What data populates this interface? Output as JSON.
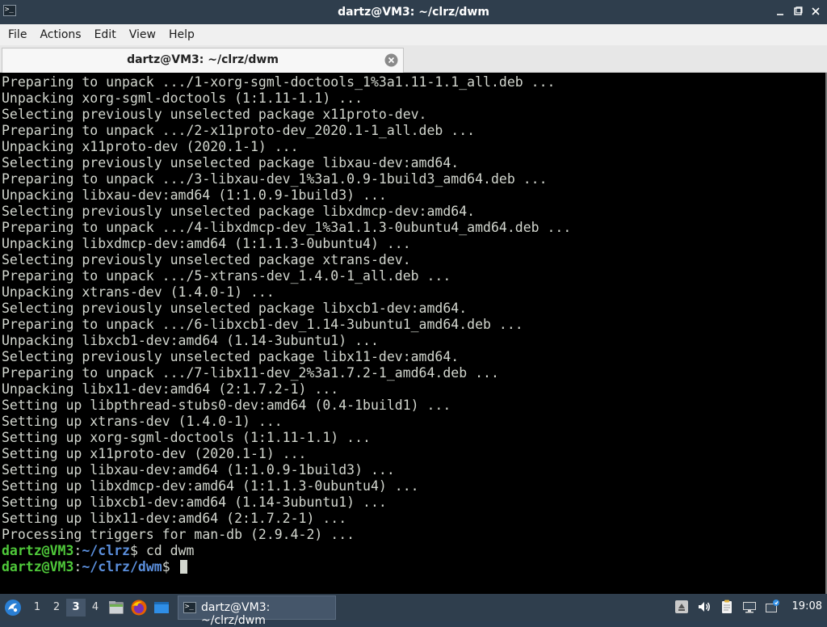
{
  "window": {
    "title": "dartz@VM3: ~/clrz/dwm",
    "app_icon_glyph": ">_"
  },
  "menubar": {
    "items": [
      "File",
      "Actions",
      "Edit",
      "View",
      "Help"
    ]
  },
  "tab": {
    "label": "dartz@VM3: ~/clrz/dwm"
  },
  "terminal": {
    "lines": [
      "Preparing to unpack .../1-xorg-sgml-doctools_1%3a1.11-1.1_all.deb ...",
      "Unpacking xorg-sgml-doctools (1:1.11-1.1) ...",
      "Selecting previously unselected package x11proto-dev.",
      "Preparing to unpack .../2-x11proto-dev_2020.1-1_all.deb ...",
      "Unpacking x11proto-dev (2020.1-1) ...",
      "Selecting previously unselected package libxau-dev:amd64.",
      "Preparing to unpack .../3-libxau-dev_1%3a1.0.9-1build3_amd64.deb ...",
      "Unpacking libxau-dev:amd64 (1:1.0.9-1build3) ...",
      "Selecting previously unselected package libxdmcp-dev:amd64.",
      "Preparing to unpack .../4-libxdmcp-dev_1%3a1.1.3-0ubuntu4_amd64.deb ...",
      "Unpacking libxdmcp-dev:amd64 (1:1.1.3-0ubuntu4) ...",
      "Selecting previously unselected package xtrans-dev.",
      "Preparing to unpack .../5-xtrans-dev_1.4.0-1_all.deb ...",
      "Unpacking xtrans-dev (1.4.0-1) ...",
      "Selecting previously unselected package libxcb1-dev:amd64.",
      "Preparing to unpack .../6-libxcb1-dev_1.14-3ubuntu1_amd64.deb ...",
      "Unpacking libxcb1-dev:amd64 (1.14-3ubuntu1) ...",
      "Selecting previously unselected package libx11-dev:amd64.",
      "Preparing to unpack .../7-libx11-dev_2%3a1.7.2-1_amd64.deb ...",
      "Unpacking libx11-dev:amd64 (2:1.7.2-1) ...",
      "Setting up libpthread-stubs0-dev:amd64 (0.4-1build1) ...",
      "Setting up xtrans-dev (1.4.0-1) ...",
      "Setting up xorg-sgml-doctools (1:1.11-1.1) ...",
      "Setting up x11proto-dev (2020.1-1) ...",
      "Setting up libxau-dev:amd64 (1:1.0.9-1build3) ...",
      "Setting up libxdmcp-dev:amd64 (1:1.1.3-0ubuntu4) ...",
      "Setting up libxcb1-dev:amd64 (1.14-3ubuntu1) ...",
      "Setting up libx11-dev:amd64 (2:1.7.2-1) ...",
      "Processing triggers for man-db (2.9.4-2) ..."
    ],
    "prompts": [
      {
        "user": "dartz@VM3",
        "sep": ":",
        "path": "~/clrz",
        "symbol": "$",
        "command": " cd dwm"
      },
      {
        "user": "dartz@VM3",
        "sep": ":",
        "path": "~/clrz/dwm",
        "symbol": "$",
        "command": " "
      }
    ]
  },
  "taskbar": {
    "desktops": [
      "1",
      "2",
      "3",
      "4"
    ],
    "active_desktop": "3",
    "task_label": "dartz@VM3: ~/clrz/dwm",
    "task_icon_glyph": ">_",
    "clock": "19:08"
  },
  "colors": {
    "terminal_bg": "#000000",
    "terminal_fg": "#d3d7cf",
    "prompt_user": "#4fc93a",
    "prompt_path": "#5b8fdc",
    "titlebar_bg": "#2f3e4d"
  },
  "icons": {
    "minimize": "minimize-icon",
    "maximize": "maximize-icon",
    "close": "close-icon",
    "tab_close": "tab-close-icon",
    "start": "lxqt-start-icon",
    "file_manager": "file-manager-icon",
    "browser": "firefox-icon",
    "show_desktop": "show-desktop-icon",
    "tray": [
      "removable-media-icon",
      "volume-icon",
      "clipboard-icon",
      "network-icon",
      "update-notifier-icon"
    ]
  }
}
